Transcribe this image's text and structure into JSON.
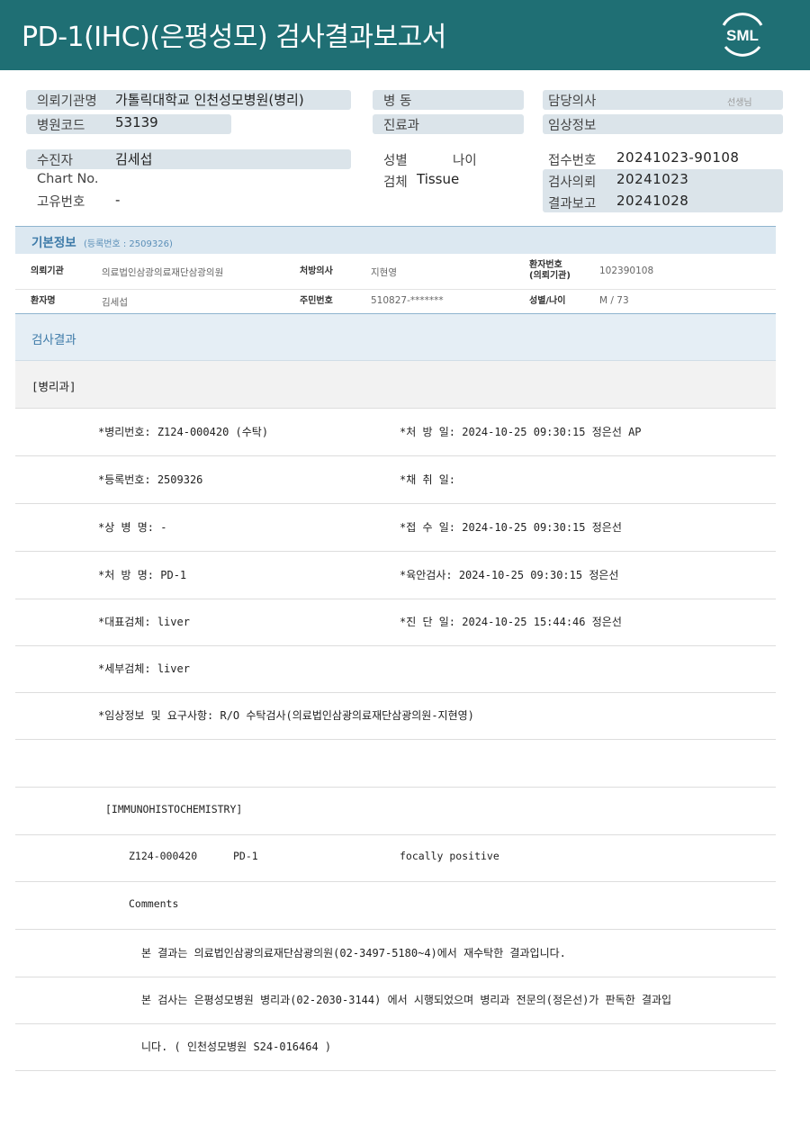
{
  "header": {
    "title": "PD-1(IHC)(은평성모) 검사결과보고서",
    "logo_text": "SML"
  },
  "patient": {
    "institution_label": "의뢰기관명",
    "institution_value": "가톨릭대학교 인천성모병원(병리)",
    "hospital_code_label": "병원코드",
    "hospital_code_value": "53139",
    "ward_label": "병  동",
    "dept_label": "진료과",
    "doctor_label": "담당의사",
    "doctor_suffix": "선생님",
    "clinical_label": "임상정보",
    "recipient_label": "수진자",
    "recipient_value": "김세섭",
    "chart_label": "Chart No.",
    "unique_label": "고유번호",
    "unique_value": "-",
    "sex_label": "성별",
    "age_label": "나이",
    "specimen_label": "검체",
    "specimen_value": "Tissue",
    "receipt_label": "접수번호",
    "receipt_value": "20241023-90108",
    "request_label": "검사의뢰",
    "request_value": "20241023",
    "report_label": "결과보고",
    "report_value": "20241028"
  },
  "basic_info": {
    "title": "기본정보",
    "reg_no": "(등록번호 : 2509326)",
    "institution_key": "의뢰기관",
    "institution_val": "의료법인삼광의료재단삼광의원",
    "prescriber_key": "처방의사",
    "prescriber_val": "지현영",
    "patient_no_key_1": "환자번호",
    "patient_no_key_2": "(의뢰기관)",
    "patient_no_val": "102390108",
    "name_key": "환자명",
    "name_val": "김세섭",
    "rrn_key": "주민번호",
    "rrn_val": "510827-*******",
    "sexage_key": "성별/나이",
    "sexage_val": "M / 73"
  },
  "results": {
    "title": "검사결과",
    "dept": "[병리과]",
    "rows": [
      {
        "left": "*병리번호: Z124-000420 (수탁)",
        "right": "*처 방 일: 2024-10-25 09:30:15  정은선 AP"
      },
      {
        "left": "*등록번호: 2509326",
        "right": "*채 취 일:"
      },
      {
        "left": "*상 병 명: -",
        "right": "*접 수 일: 2024-10-25 09:30:15  정은선"
      },
      {
        "left": "*처 방 명: PD-1",
        "right": "*육안검사: 2024-10-25 09:30:15  정은선"
      },
      {
        "left": "*대표검체: liver",
        "right": "*진 단 일: 2024-10-25 15:44:46  정은선"
      },
      {
        "left": "*세부검체: liver",
        "right": ""
      },
      {
        "left": "*임상정보 및 요구사항: R/O 수탁검사(의료법인삼광의료재단삼광의원-지현영)",
        "right": ""
      }
    ],
    "ihc_header": "[IMMUNOHISTOCHEMISTRY]",
    "ihc_case": "Z124-000420",
    "ihc_marker": "PD-1",
    "ihc_result": "focally positive",
    "comments_label": "Comments",
    "comment_1": "본 결과는 의료법인삼광의료재단삼광의원(02-3497-5180~4)에서 재수탁한 결과입니다.",
    "comment_2": "본 검사는 은평성모병원 병리과(02-2030-3144) 에서 시행되었으며 병리과 전문의(정은선)가 판독한 결과입",
    "comment_3": "니다. ( 인천성모병원 S24-016464 )"
  }
}
